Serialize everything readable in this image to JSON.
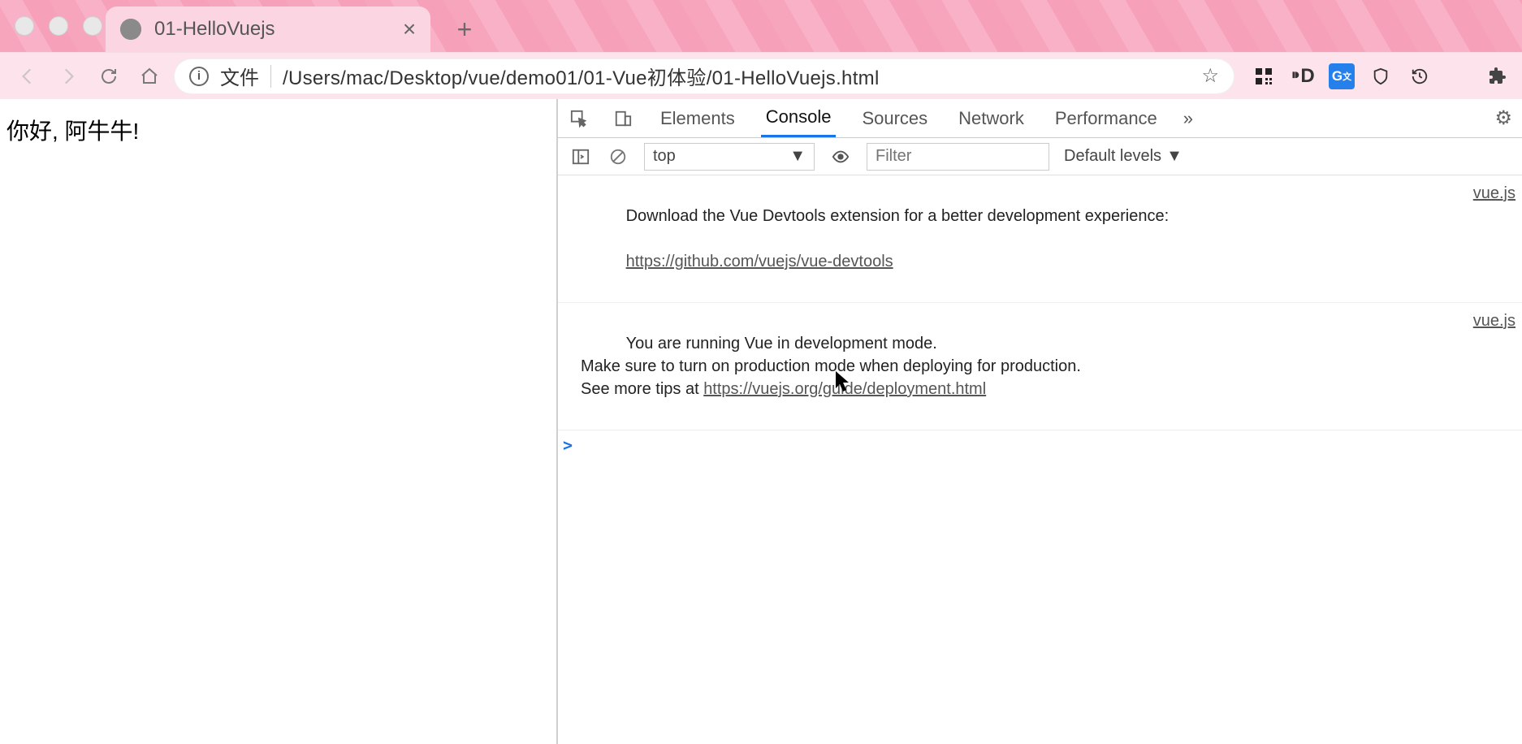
{
  "tab": {
    "title": "01-HelloVuejs"
  },
  "address": {
    "scheme_label": "文件",
    "path": "/Users/mac/Desktop/vue/demo01/01-Vue初体验/01-HelloVuejs.html"
  },
  "page": {
    "heading": "你好, 阿牛牛!"
  },
  "devtools": {
    "tabs": [
      "Elements",
      "Console",
      "Sources",
      "Network",
      "Performance"
    ],
    "active_tab": "Console",
    "context": "top",
    "filter_placeholder": "Filter",
    "levels_label": "Default levels",
    "logs": [
      {
        "text": "Download the Vue Devtools extension for a better development experience:",
        "link": "https://github.com/vuejs/vue-devtools",
        "source": "vue.js"
      },
      {
        "text": "You are running Vue in development mode.\nMake sure to turn on production mode when deploying for production.\nSee more tips at ",
        "link": "https://vuejs.org/guide/deployment.html",
        "source": "vue.js"
      }
    ],
    "prompt": ">"
  }
}
